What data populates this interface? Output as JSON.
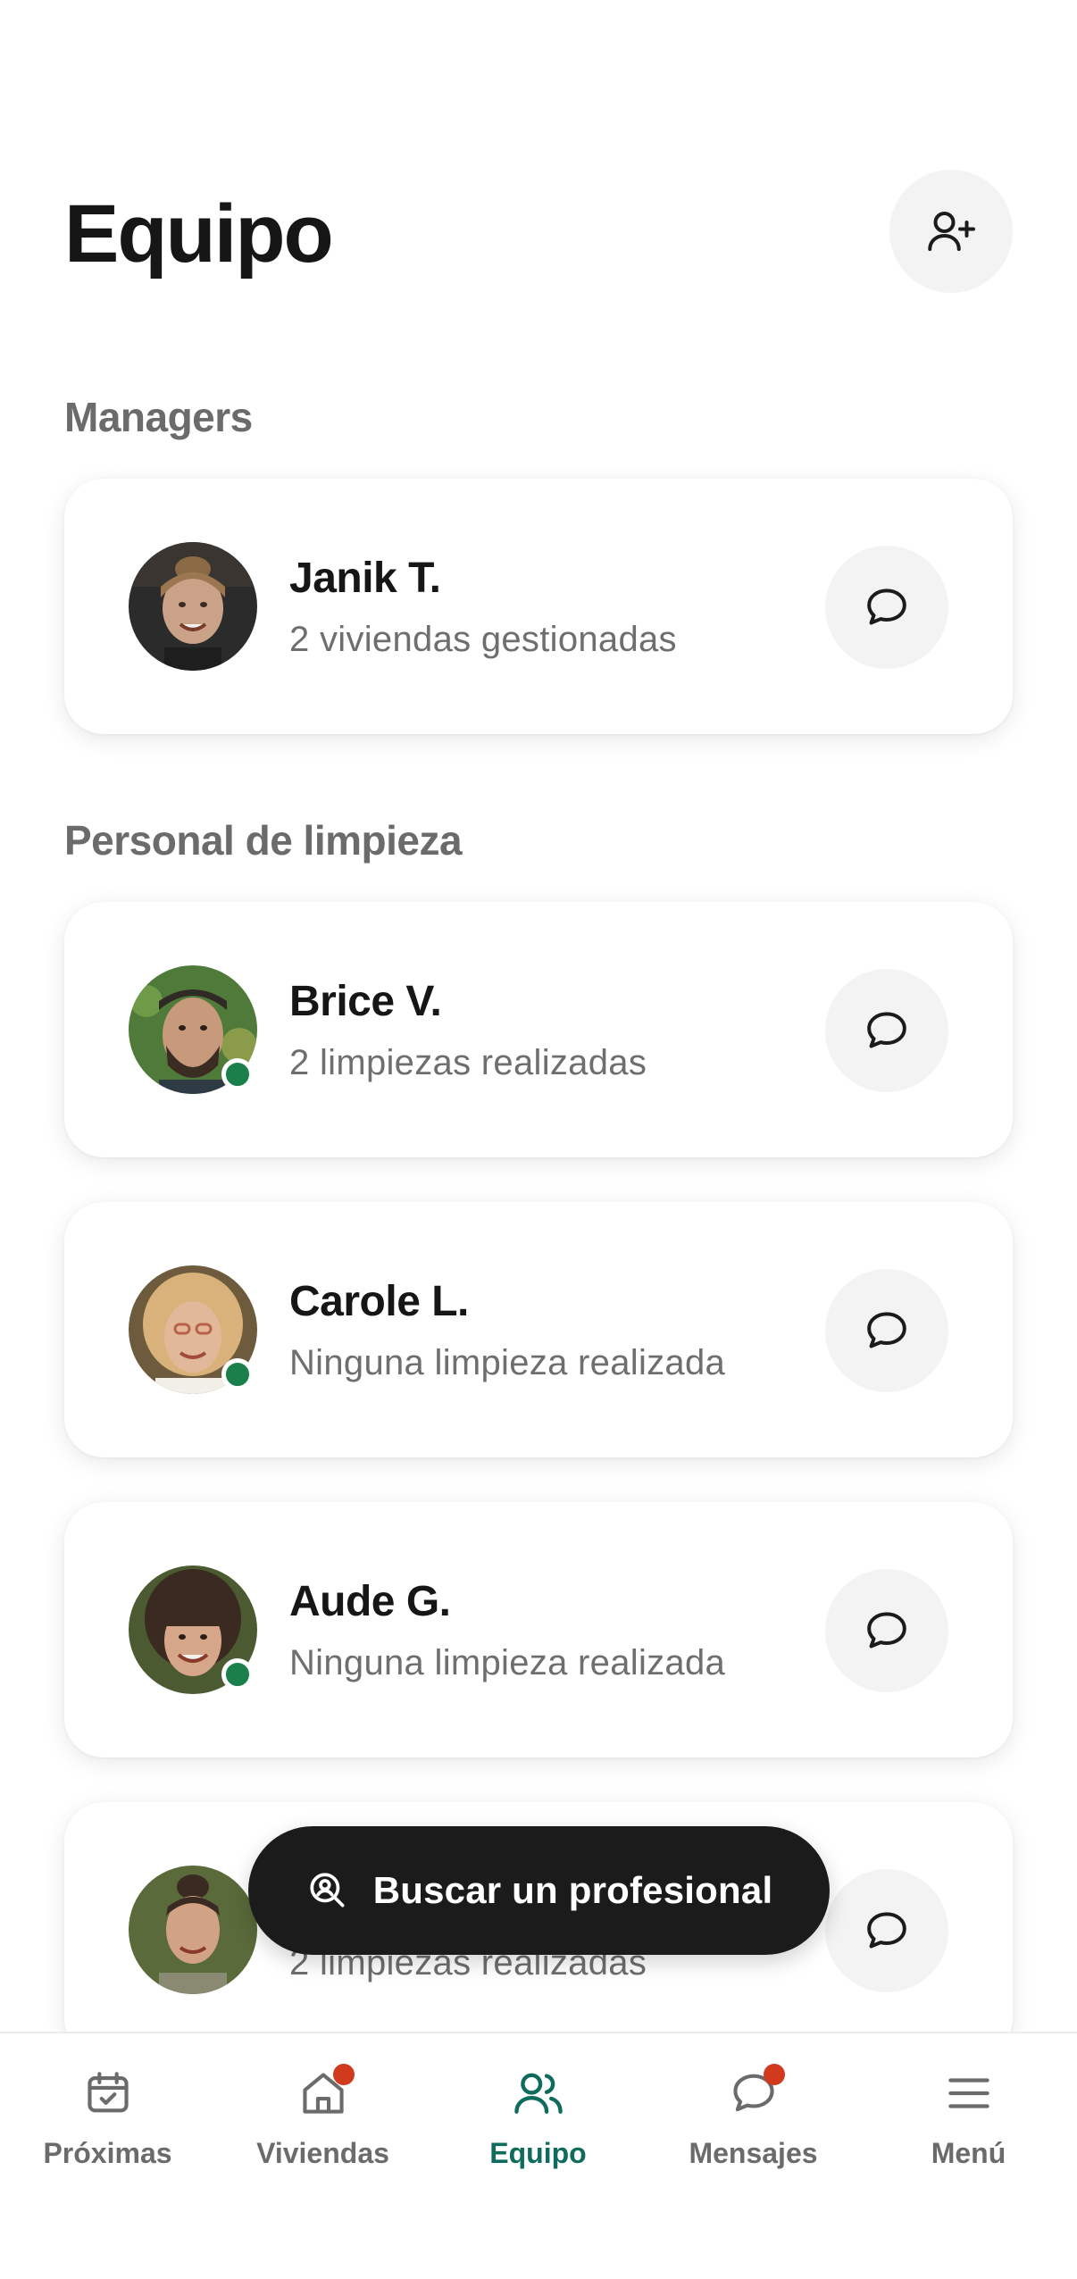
{
  "header": {
    "title": "Equipo",
    "add_icon": "user-plus-icon"
  },
  "sections": {
    "managers": "Managers",
    "cleaning": "Personal de limpieza"
  },
  "managers": [
    {
      "name": "Janik T.",
      "subtitle": "2 viviendas gestionadas",
      "online": false
    }
  ],
  "cleaners": [
    {
      "name": "Brice V.",
      "subtitle": "2 limpiezas realizadas",
      "online": true
    },
    {
      "name": "Carole L.",
      "subtitle": "Ninguna limpieza realizada",
      "online": true
    },
    {
      "name": "Aude G.",
      "subtitle": "Ninguna limpieza realizada",
      "online": true
    },
    {
      "name": "",
      "subtitle": "2 limpiezas realizadas",
      "online": false
    }
  ],
  "fab": {
    "label": "Buscar un profesional",
    "icon": "search-person-icon"
  },
  "nav": [
    {
      "label": "Próximas",
      "icon": "calendar-check-icon",
      "badge": false,
      "active": false
    },
    {
      "label": "Viviendas",
      "icon": "home-icon",
      "badge": true,
      "active": false
    },
    {
      "label": "Equipo",
      "icon": "users-icon",
      "badge": false,
      "active": true
    },
    {
      "label": "Mensajes",
      "icon": "chat-icon",
      "badge": true,
      "active": false
    },
    {
      "label": "Menú",
      "icon": "menu-icon",
      "badge": false,
      "active": false
    }
  ],
  "colors": {
    "accent": "#0f6b5c",
    "online": "#1a7f4b",
    "badge": "#d23a1e",
    "fab": "#1b1b1b"
  }
}
